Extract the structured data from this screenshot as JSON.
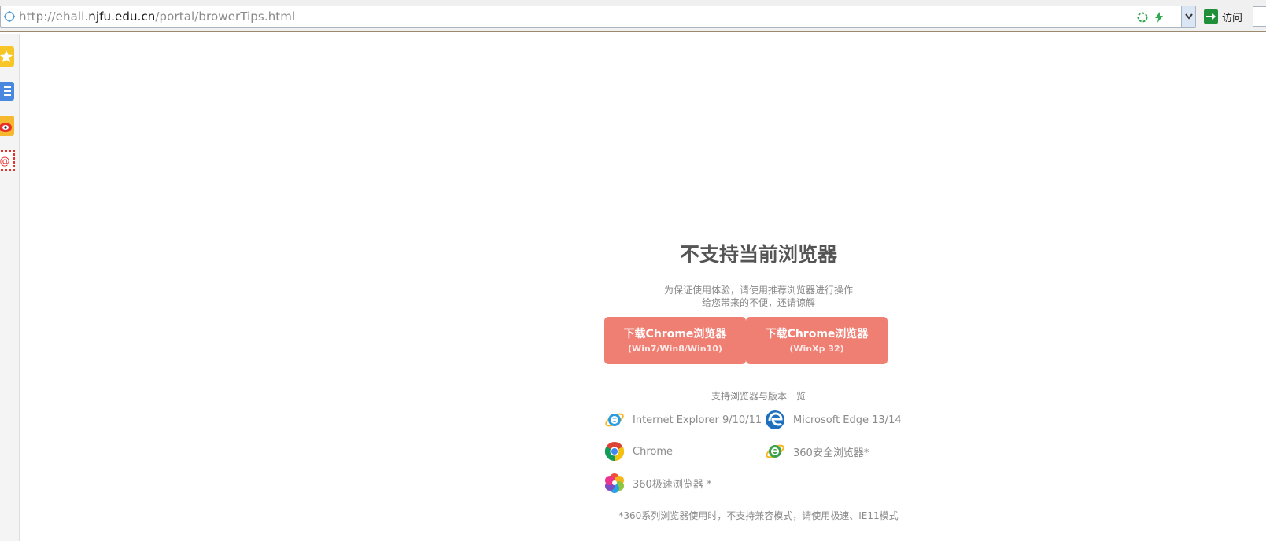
{
  "browser": {
    "url_scheme_host_prefix": "http://ehall.",
    "url_host": "njfu.edu.cn",
    "url_path": "/portal/browerTips.html",
    "visit_label": "访问"
  },
  "sidebar": {
    "items": [
      {
        "icon": "favorites-star-icon"
      },
      {
        "icon": "notes-list-icon"
      },
      {
        "icon": "weibo-icon"
      },
      {
        "icon": "email-at-icon"
      }
    ]
  },
  "page": {
    "title": "不支持当前浏览器",
    "subtitle_line1": "为保证使用体验，请使用推荐浏览器进行操作",
    "subtitle_line2": "给您带来的不便，还请谅解",
    "buttons": [
      {
        "label": "下载Chrome浏览器",
        "sub": "(Win7/Win8/Win10)"
      },
      {
        "label": "下载Chrome浏览器",
        "sub": "(WinXp 32)"
      }
    ],
    "supported_heading": "支持浏览器与版本一览",
    "browsers": [
      {
        "name": "Internet Explorer 9/10/11",
        "icon": "internet-explorer-icon"
      },
      {
        "name": "Microsoft Edge 13/14",
        "icon": "microsoft-edge-icon"
      },
      {
        "name": "Chrome",
        "icon": "chrome-icon"
      },
      {
        "name": "360安全浏览器*",
        "icon": "360-safe-browser-icon"
      },
      {
        "name": "360极速浏览器 *",
        "icon": "360-speed-browser-icon"
      }
    ],
    "note": "*360系列浏览器使用时，不支持兼容模式，请使用极速、IE11模式"
  },
  "colors": {
    "button_bg": "#ef7e73",
    "title": "#555555",
    "muted_text": "#888888"
  }
}
